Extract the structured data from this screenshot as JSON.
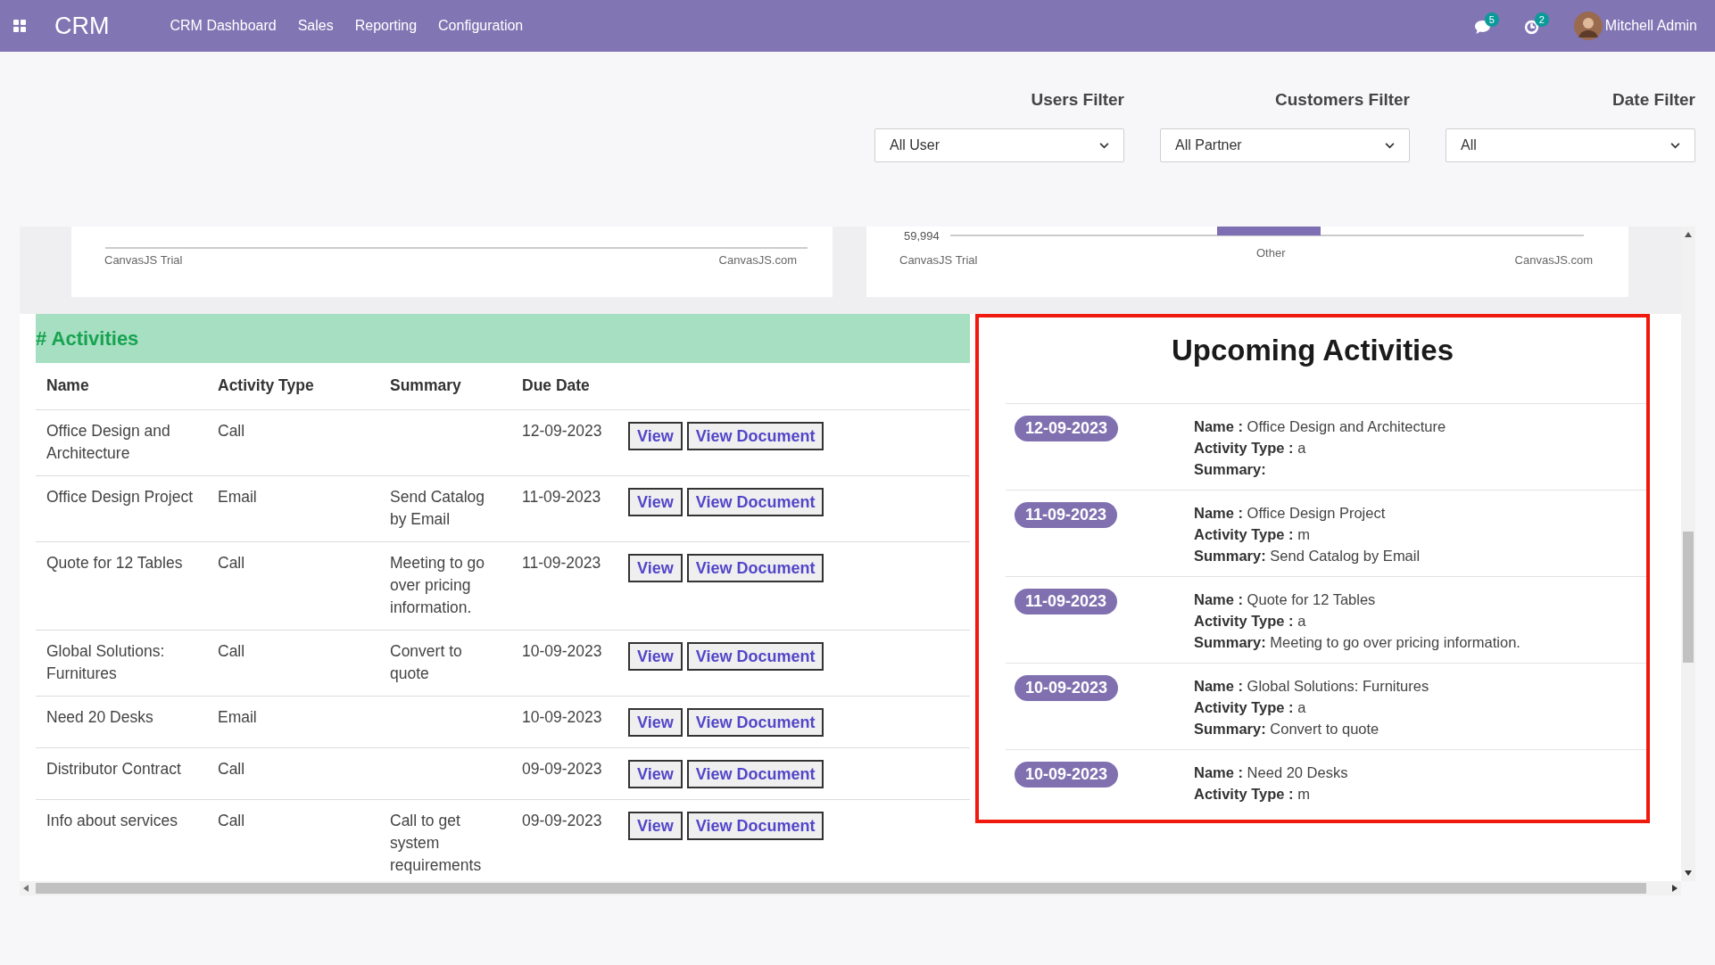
{
  "navbar": {
    "app_name": "CRM",
    "menu": [
      "CRM Dashboard",
      "Sales",
      "Reporting",
      "Configuration"
    ],
    "messages_count": "5",
    "activities_count": "2",
    "user_name": "Mitchell Admin"
  },
  "filters": [
    {
      "label": "Users Filter",
      "value": "All User"
    },
    {
      "label": "Customers Filter",
      "value": "All Partner"
    },
    {
      "label": "Date Filter",
      "value": "All"
    }
  ],
  "charts": [
    {
      "kind": "axis",
      "credits": [
        "CanvasJS Trial",
        "CanvasJS.com"
      ]
    },
    {
      "kind": "bar",
      "y_tick_label": "59,994",
      "category_label": "Other",
      "credits": [
        "CanvasJS Trial",
        "CanvasJS.com"
      ]
    }
  ],
  "activities": {
    "title": "# Activities",
    "columns": [
      "Name",
      "Activity Type",
      "Summary",
      "Due Date"
    ],
    "rows": [
      {
        "name": "Office Design and Architecture",
        "activity_type": "Call",
        "due_date": "12-09-2023",
        "actions": [
          "View",
          "View Document"
        ]
      },
      {
        "name": "Office Design Project",
        "activity_type": "Email",
        "summary": "Send Catalog by Email",
        "due_date": "11-09-2023",
        "actions": [
          "View",
          "View Document"
        ]
      },
      {
        "name": "Quote for 12 Tables",
        "activity_type": "Call",
        "summary": "Meeting to go over pricing information.",
        "due_date": "11-09-2023",
        "actions": [
          "View",
          "View Document"
        ]
      },
      {
        "name": "Global Solutions: Furnitures",
        "activity_type": "Call",
        "summary": "Convert to quote",
        "due_date": "10-09-2023",
        "actions": [
          "View",
          "View Document"
        ]
      },
      {
        "name": "Need 20 Desks",
        "activity_type": "Email",
        "due_date": "10-09-2023",
        "actions": [
          "View",
          "View Document"
        ]
      },
      {
        "name": "Distributor Contract",
        "activity_type": "Call",
        "due_date": "09-09-2023",
        "actions": [
          "View",
          "View Document"
        ]
      },
      {
        "name": "Info about services",
        "activity_type": "Call",
        "summary": "Call to get system requirements",
        "due_date": "09-09-2023",
        "actions": [
          "View",
          "View Document"
        ]
      }
    ]
  },
  "upcoming": {
    "title": "Upcoming Activities",
    "highlighted": true,
    "items": [
      {
        "date": "12-09-2023",
        "fields": [
          {
            "label": "Name :",
            "value": "Office Design and Architecture"
          },
          {
            "label": "Activity Type :",
            "value": "a"
          },
          {
            "label": "Summary:"
          }
        ]
      },
      {
        "date": "11-09-2023",
        "fields": [
          {
            "label": "Name :",
            "value": "Office Design Project"
          },
          {
            "label": "Activity Type :",
            "value": "m"
          },
          {
            "label": "Summary:",
            "value": "Send Catalog by Email"
          }
        ]
      },
      {
        "date": "11-09-2023",
        "fields": [
          {
            "label": "Name :",
            "value": "Quote for 12 Tables"
          },
          {
            "label": "Activity Type :",
            "value": "a"
          },
          {
            "label": "Summary:",
            "value": "Meeting to go over pricing information."
          }
        ]
      },
      {
        "date": "10-09-2023",
        "fields": [
          {
            "label": "Name :",
            "value": "Global Solutions: Furnitures"
          },
          {
            "label": "Activity Type :",
            "value": "a"
          },
          {
            "label": "Summary:",
            "value": "Convert to quote"
          }
        ]
      },
      {
        "date": "10-09-2023",
        "fields": [
          {
            "label": "Name :",
            "value": "Need 20 Desks"
          },
          {
            "label": "Activity Type :",
            "value": "m"
          }
        ]
      }
    ]
  }
}
